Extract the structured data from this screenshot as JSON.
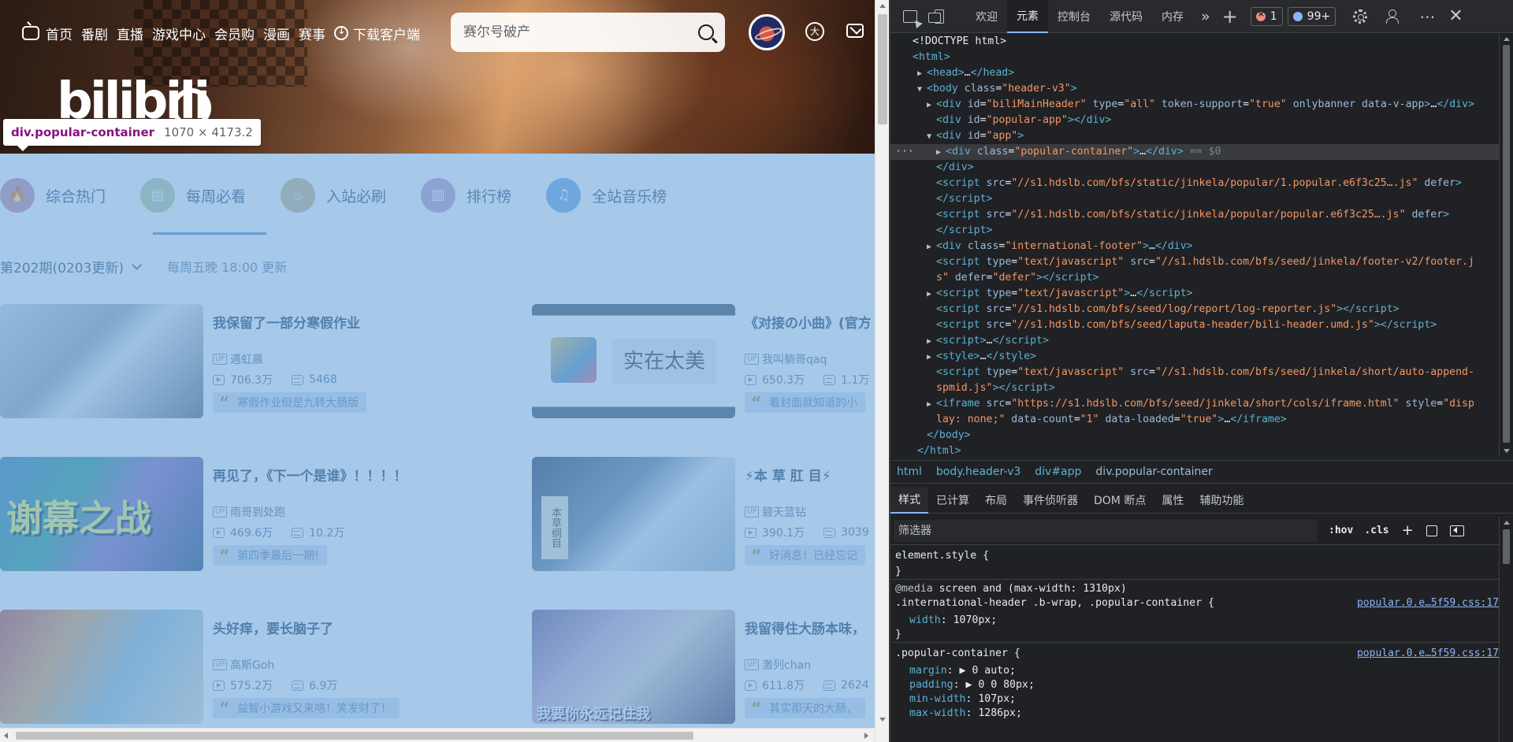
{
  "page": {
    "nav": [
      "首页",
      "番剧",
      "直播",
      "游戏中心",
      "会员购",
      "漫画",
      "赛事",
      "下载客户端"
    ],
    "search_placeholder": "赛尔号破产",
    "logo_text": "bilibili",
    "avatar_badge_glyph": "大",
    "tooltip": {
      "tag": "div.popular-container",
      "size": "1070 × 4173.2"
    },
    "tabs": [
      {
        "label": "综合热门",
        "color": "#c98aa7",
        "glyph": "🔥"
      },
      {
        "label": "每周必看",
        "color": "#b9c79d",
        "glyph": "▤"
      },
      {
        "label": "入站必刷",
        "color": "#c9b58a",
        "glyph": "♨"
      },
      {
        "label": "排行榜",
        "color": "#b89ac2",
        "glyph": "▥"
      },
      {
        "label": "全站音乐榜",
        "color": "#6aa6e0",
        "glyph": "♫"
      }
    ],
    "issue": "第202期(0203更新)",
    "issue_note": "每周五晚 18:00 更新",
    "cards": [
      {
        "title": "我保留了一部分寒假作业",
        "up": "遇虹晨",
        "views": "706.3万",
        "danmaku": "5468",
        "rec": "寒假作业但是九转大肠版",
        "thumb_text": ""
      },
      {
        "title": "《对接の小曲》(官方",
        "up": "我叫躺哥qaq",
        "views": "650.3万",
        "danmaku": "1.1万",
        "rec": "看封面就知道的小",
        "thumb_text": "实在太美"
      },
      {
        "title": "再见了，《下一个是谁》！！！！",
        "up": "雨哥到处跑",
        "views": "469.6万",
        "danmaku": "10.2万",
        "rec": "第四季最后一期!",
        "thumb_text": "谢幕之战"
      },
      {
        "title": "⚡本 草 肛 目⚡",
        "up": "碧天蓝钻",
        "views": "390.1万",
        "danmaku": "3039",
        "rec": "好消息！已经忘记",
        "thumb_text": "本草纲目"
      },
      {
        "title": "头好痒，要长脑子了",
        "up": "高斯Goh",
        "views": "575.2万",
        "danmaku": "6.9万",
        "rec": "益智小游戏又来咯！笑发财了！",
        "thumb_text": ""
      },
      {
        "title": "我留得住大肠本味，",
        "up": "激列chan",
        "views": "611.8万",
        "danmaku": "2624",
        "rec": "其实那天的大肠，",
        "thumb_text": "我要你永远记住我"
      }
    ],
    "up_badge": "UP"
  },
  "devtools": {
    "tabs": [
      "欢迎",
      "元素",
      "控制台",
      "源代码",
      "内存"
    ],
    "active_tab": "元素",
    "error_count": "1",
    "message_count": "99+",
    "breadcrumbs": [
      "html",
      "body.header-v3",
      "div#app",
      "div.popular-container"
    ],
    "style_tabs": [
      "样式",
      "已计算",
      "布局",
      "事件侦听器",
      "DOM 断点",
      "属性",
      "辅助功能"
    ],
    "filter_placeholder": "筛选器",
    "filter_buttons": [
      ":hov",
      ".cls"
    ],
    "styles": {
      "element_style": "element.style {",
      "close": "}",
      "media": "@media",
      "media_query": "screen and (max-width: 1310px)",
      "rule1_selector": ".international-header .b-wrap, .popular-container {",
      "rule1_src": "popular.0.e…5f59.css:17",
      "rule1_prop": "width",
      "rule1_val": "1070px;",
      "rule2_selector": ".popular-container {",
      "rule2_src": "popular.0.e…5f59.css:17",
      "rule2_props": [
        {
          "p": "margin",
          "v": "▶ 0 auto;"
        },
        {
          "p": "padding",
          "v": "▶ 0 0 80px;"
        },
        {
          "p": "min-width",
          "v": "107px;"
        },
        {
          "p": "max-width",
          "v": "1286px;"
        }
      ]
    }
  }
}
